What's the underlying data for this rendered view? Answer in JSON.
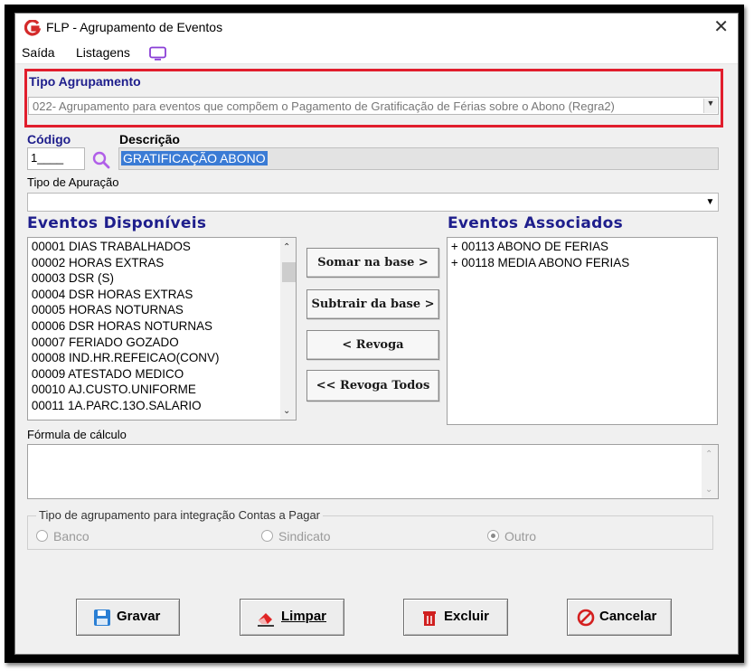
{
  "window": {
    "title": "FLP - Agrupamento de Eventos",
    "close_symbol": "✕"
  },
  "menu": {
    "items": [
      "Saída",
      "Listagens"
    ]
  },
  "tipo_agrupamento": {
    "label": "Tipo Agrupamento",
    "value": "022- Agrupamento para eventos que compõem o Pagamento de Gratificação de Férias sobre o Abono (Regra2)"
  },
  "codigo": {
    "label": "Código",
    "value": "1____"
  },
  "descricao": {
    "label": "Descrição",
    "value": "GRATIFICAÇÃO ABONO"
  },
  "tipo_apuracao": {
    "label": "Tipo de Apuração",
    "value": ""
  },
  "eventos_disponiveis": {
    "label": "Eventos Disponíveis",
    "items": [
      "00001 DIAS TRABALHADOS",
      "00002 HORAS EXTRAS",
      "00003 DSR (S)",
      "00004 DSR HORAS EXTRAS",
      "00005 HORAS NOTURNAS",
      "00006 DSR HORAS NOTURNAS",
      "00007 FERIADO GOZADO",
      "00008 IND.HR.REFEICAO(CONV)",
      "00009 ATESTADO MEDICO",
      "00010 AJ.CUSTO.UNIFORME",
      "00011 1A.PARC.13O.SALARIO"
    ]
  },
  "eventos_associados": {
    "label": "Eventos Associados",
    "items": [
      "+ 00113 ABONO DE FERIAS",
      "+ 00118 MEDIA ABONO FERIAS"
    ]
  },
  "transfer_buttons": {
    "somar": "Somar  na base >",
    "subtrair": "Subtrair da base >",
    "revoga": "< Revoga",
    "revoga_todos": "<< Revoga Todos"
  },
  "formula": {
    "label": "Fórmula de cálculo",
    "value": ""
  },
  "contas_pagar": {
    "legend": "Tipo de agrupamento para integração Contas a Pagar",
    "options": [
      {
        "label": "Banco",
        "selected": false
      },
      {
        "label": "Sindicato",
        "selected": false
      },
      {
        "label": "Outro",
        "selected": true
      }
    ]
  },
  "footer_buttons": {
    "gravar": "Gravar",
    "limpar": "Limpar",
    "excluir": "Excluir",
    "cancelar": "Cancelar"
  },
  "colors": {
    "accent_blue": "#1e1e8c",
    "highlight_red": "#e11e2d",
    "selection_blue": "#0078d7"
  }
}
